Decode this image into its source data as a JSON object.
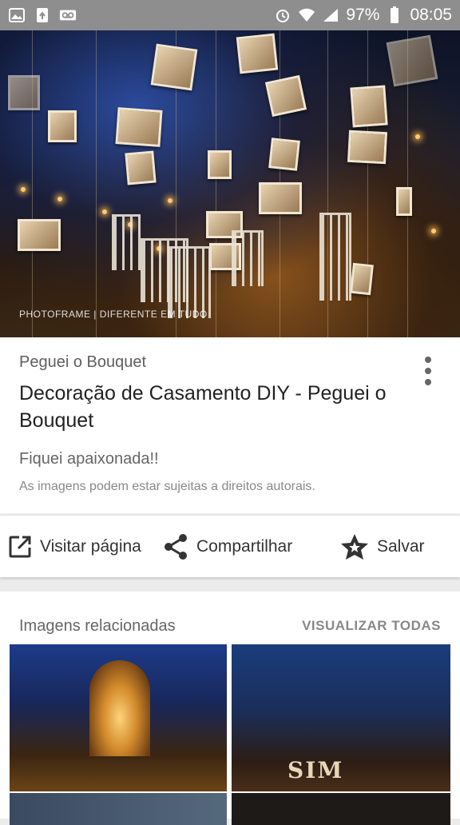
{
  "status_bar": {
    "battery": "97%",
    "time": "08:05",
    "left_icons": [
      "image-icon",
      "recycle-icon",
      "voicemail-icon"
    ],
    "right_icons": [
      "alarm-icon",
      "wifi-icon",
      "signal-icon",
      "battery-icon"
    ]
  },
  "hero": {
    "watermark": "PHOTOFRAME | DIFERENTE EM TUDO"
  },
  "card": {
    "source": "Peguei o Bouquet",
    "title": "Decoração de Casamento DIY - Peguei o Bouquet",
    "description": "Fiquei apaixonada!!",
    "copyright": "As imagens podem estar sujeitas a direitos autorais."
  },
  "actions": {
    "visit": "Visitar página",
    "share": "Compartilhar",
    "save": "Salvar"
  },
  "related": {
    "title": "Imagens relacionadas",
    "view_all": "VISUALIZAR TODAS",
    "thumb2_text": "SIM"
  },
  "colors": {
    "status_bar": "#8e8e8e",
    "card_bg": "#ffffff",
    "page_bg": "#ececec"
  }
}
